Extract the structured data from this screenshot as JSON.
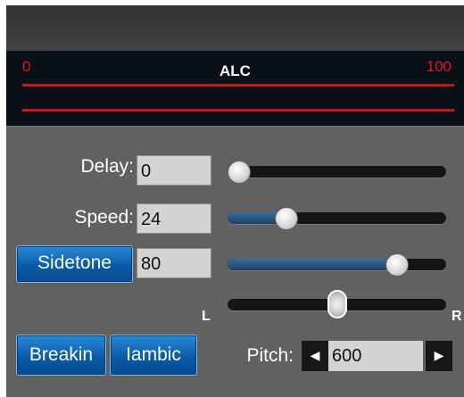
{
  "meter": {
    "title": "ALC",
    "min_label": "0",
    "max_label": "100"
  },
  "controls": {
    "delay": {
      "label": "Delay:",
      "value": "0",
      "slider_fraction": 0.0
    },
    "speed": {
      "label": "Speed:",
      "value": "24",
      "slider_fraction": 0.24
    },
    "sidetone": {
      "button_label": "Sidetone",
      "value": "80",
      "slider_fraction": 0.8
    },
    "pan": {
      "left_label": "L",
      "right_label": "R",
      "slider_fraction": 0.5
    },
    "breakin_label": "Breakin",
    "iambic_label": "Iambic",
    "pitch": {
      "label": "Pitch:",
      "value": "600",
      "decrease_icon": "triangle-left-icon",
      "increase_icon": "triangle-right-icon"
    }
  },
  "colors": {
    "accent_button": "#0a5ba8",
    "meter_red": "#d21414",
    "meter_background": "#0a1018",
    "panel_gray": "#616161"
  }
}
